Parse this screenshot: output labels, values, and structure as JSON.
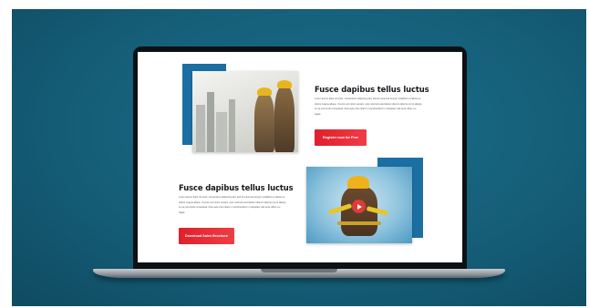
{
  "colors": {
    "background": "#155e78",
    "accent_blue": "#1c6fa3",
    "button_red": "#e11f2c"
  },
  "section_1": {
    "title": "Fusce dapibus tellus luctus",
    "body": "Lorem ipsum dolor sit amet, consectetur adipiscing elit, sed do eiusmod tempor incididunt ut labore et dolore magna aliqua. Ut enim ad minim veniam, quis nostrud exercitation ullamco laboris nisi ut aliquip ex ea commodo consequat. Duis aute irure dolor in reprehenderit in voluptate velit esse cillum eu fugiat.",
    "button_label": "Register now for Free",
    "image": "construction-workers-city-photo"
  },
  "section_2": {
    "title": "Fusce dapibus tellus luctus",
    "body": "Lorem ipsum dolor sit amet, consectetur adipiscing elit, sed do eiusmod tempor incididunt ut labore et dolore magna aliqua. Ut enim ad minim veniam, quis nostrud exercitation ullamco laboris nisi ut aliquip ex ea commodo consequat. Duis aute irure dolor in reprehenderit in voluptate velit esse cillum eu fugiat.",
    "button_label": "Download Sales Brochure",
    "image": "construction-worker-video",
    "icon": "play-icon"
  }
}
